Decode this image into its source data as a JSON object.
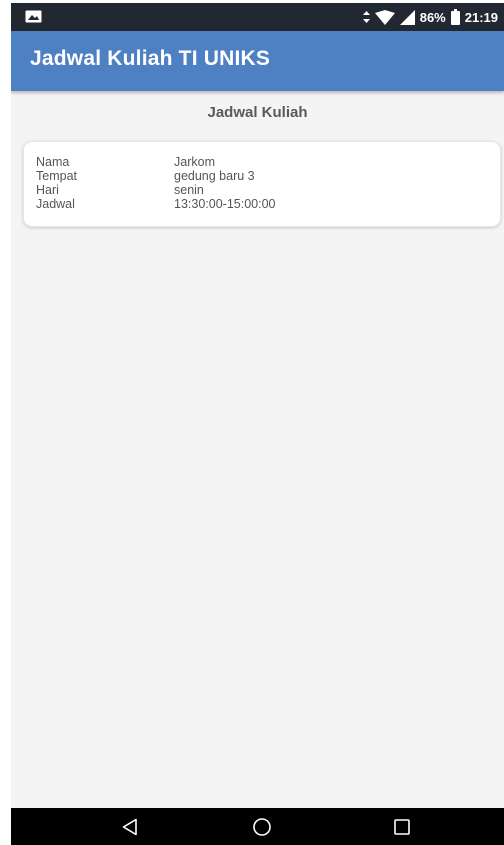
{
  "status_bar": {
    "battery": "86%",
    "time": "21:19",
    "icons": [
      "gallery-icon",
      "data-transfer-icon",
      "wifi-icon",
      "signal-icon",
      "battery-icon"
    ]
  },
  "app_bar": {
    "title": "Jadwal Kuliah TI UNIKS"
  },
  "section": {
    "heading": "Jadwal Kuliah"
  },
  "schedule_card": {
    "rows": [
      {
        "label": "Nama",
        "value": "Jarkom"
      },
      {
        "label": "Tempat",
        "value": "gedung baru 3"
      },
      {
        "label": "Hari",
        "value": "senin"
      },
      {
        "label": "Jadwal",
        "value": "13:30:00-15:00:00"
      }
    ]
  },
  "nav_bar": {
    "buttons": [
      "back-icon",
      "home-icon",
      "recents-icon"
    ]
  },
  "colors": {
    "status_bar": "#222831",
    "app_bar": "#4d81c4",
    "background": "#f4f4f4",
    "card": "#ffffff",
    "nav_bar": "#000000"
  }
}
